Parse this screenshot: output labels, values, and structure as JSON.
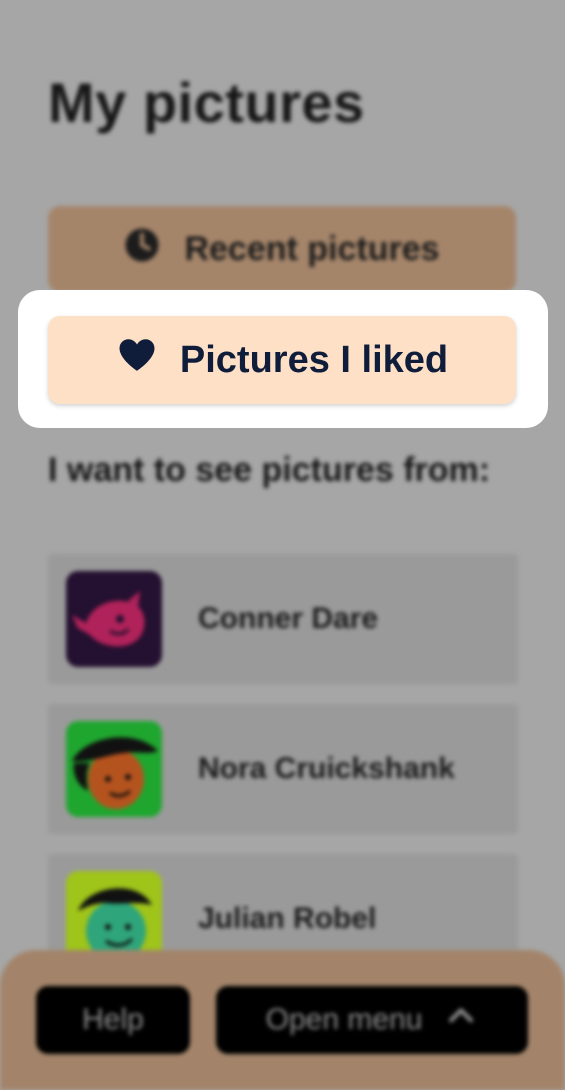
{
  "page": {
    "title": "My pictures"
  },
  "buttons": {
    "recent_label": "Recent pictures",
    "recent_icon": "clock-icon",
    "liked_label": "Pictures I liked",
    "liked_icon": "heart-icon"
  },
  "creators": {
    "heading": "I want to see pictures from:",
    "items": [
      {
        "name": "Conner Dare",
        "avatar": "fish-avatar"
      },
      {
        "name": "Nora Cruickshank",
        "avatar": "hat-face-avatar"
      },
      {
        "name": "Julian Robel",
        "avatar": "green-face-avatar"
      }
    ]
  },
  "bottom_bar": {
    "help_label": "Help",
    "menu_label": "Open menu",
    "menu_icon": "chevron-up-icon"
  },
  "colors": {
    "overlay_background": "#a6a6a6",
    "recent_button": "#a5856a",
    "liked_button": "#fde0c6",
    "liked_text": "#0f1d3b",
    "bottom_bar": "#a3846a"
  }
}
